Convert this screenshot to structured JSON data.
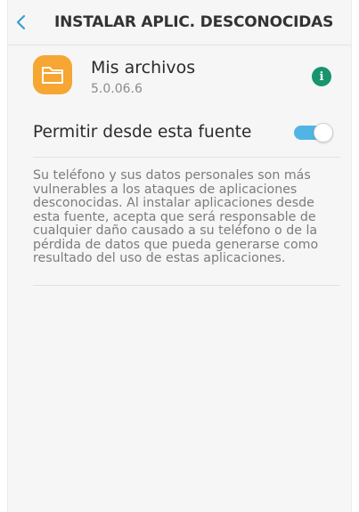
{
  "header": {
    "title": "INSTALAR APLIC. DESCONOCIDAS",
    "back_icon": "chevron-left-icon"
  },
  "app": {
    "name": "Mis archivos",
    "version": "5.0.06.6",
    "icon": "folder-icon",
    "icon_color": "#f6a632",
    "info_icon": "info-icon",
    "info_color": "#18946f"
  },
  "setting": {
    "label": "Permitir desde esta fuente",
    "enabled": true,
    "accent": "#52b4e3"
  },
  "description": "Su teléfono y sus datos personales son más vulnerables a los ataques de aplicaciones desconocidas. Al instalar aplicaciones desde esta fuente, acepta que será responsable de cualquier daño causado a su teléfono o de la pérdida de datos que pueda generarse como resultado del uso de estas aplicaciones."
}
